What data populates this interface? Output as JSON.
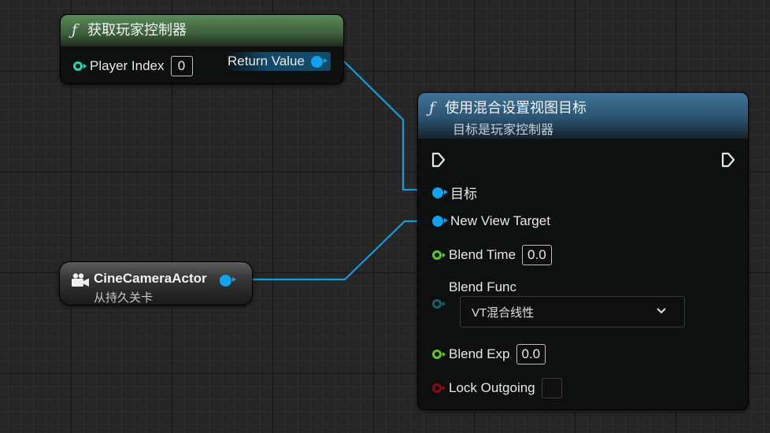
{
  "colors": {
    "object_pin": "#12a3f0",
    "struct_pin": "#2ad3b5",
    "float_pin": "#5fc52a",
    "enum_pin": "#0f7d79",
    "bool_pin": "#8a1010",
    "pure_header": "#5a8a58",
    "impure_header": "#3f7397",
    "wire": "#129ed8"
  },
  "node_get_player_controller": {
    "icon": "function-icon",
    "title": "获取玩家控制器",
    "player_index_label": "Player Index",
    "player_index_value": "0",
    "return_label": "Return Value"
  },
  "node_set_view_target": {
    "icon": "function-icon",
    "title": "使用混合设置视图目标",
    "subtitle": "目标是玩家控制器",
    "target_label": "目标",
    "new_view_target_label": "New View Target",
    "blend_time_label": "Blend Time",
    "blend_time_value": "0.0",
    "blend_func_label": "Blend Func",
    "blend_func_selected": "VT混合线性",
    "blend_exp_label": "Blend Exp",
    "blend_exp_value": "0.0",
    "lock_outgoing_label": "Lock Outgoing",
    "lock_outgoing_checked": false
  },
  "node_actor_ref": {
    "icon": "camera-icon",
    "title": "CineCameraActor",
    "subtitle": "从持久关卡"
  }
}
